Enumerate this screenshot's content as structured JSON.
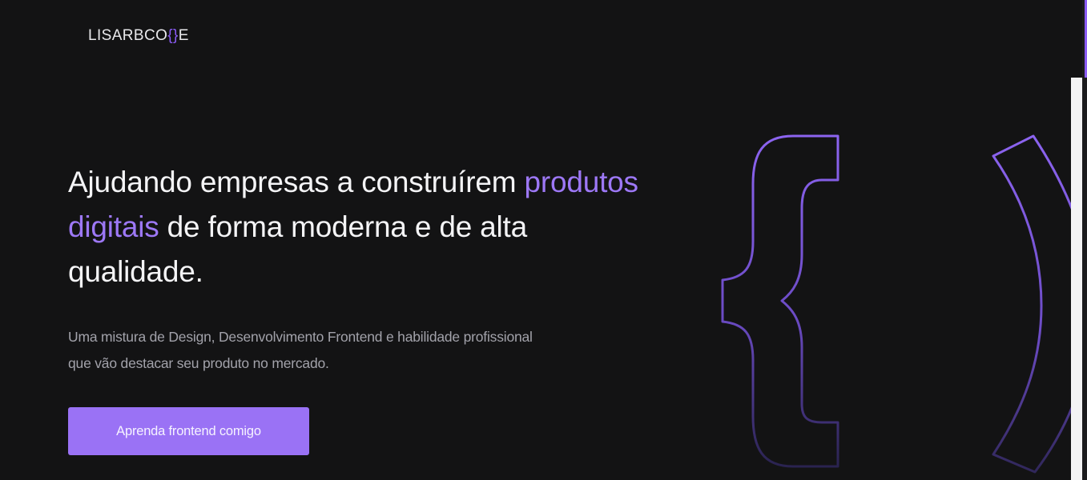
{
  "header": {
    "logo": {
      "prefix": "LISARBCO",
      "brace_open": "{",
      "brace_close": "}",
      "suffix": "E"
    }
  },
  "hero": {
    "title_part1": "Ajudando empresas a construírem ",
    "title_highlight": "produtos digitais",
    "title_part2": " de forma moderna e de alta qualidade.",
    "subtitle": "Uma mistura de Design, Desenvolvimento Frontend e habilidade profissional que vão destacar seu produto no mercado.",
    "cta_label": "Aprenda frontend comigo"
  },
  "decoration": {
    "icon": "code-braces-icon"
  },
  "colors": {
    "background": "#131314",
    "accent": "#9a72f5",
    "text": "#f4f4f6",
    "muted": "#a2a2aa"
  }
}
